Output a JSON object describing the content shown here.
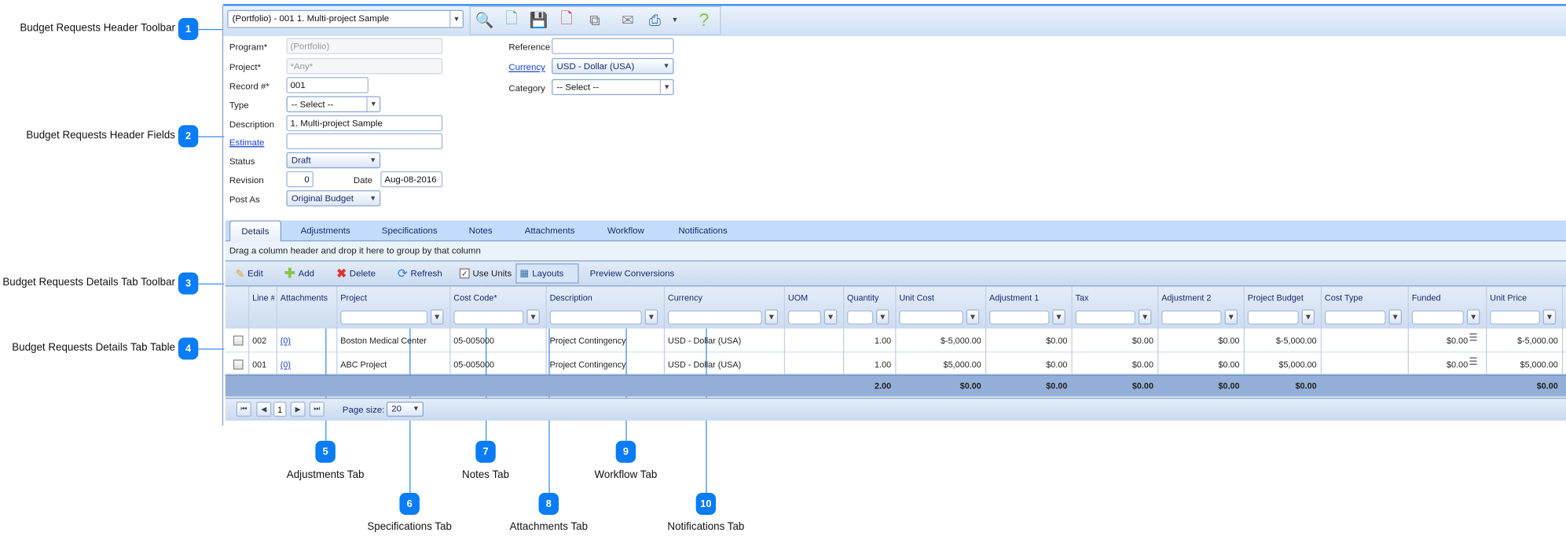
{
  "callouts": [
    {
      "n": "1",
      "label": "Budget Requests Header Toolbar"
    },
    {
      "n": "2",
      "label": "Budget Requests Header Fields"
    },
    {
      "n": "3",
      "label": "Budget Requests Details Tab Toolbar"
    },
    {
      "n": "4",
      "label": "Budget Requests Details Tab Table"
    },
    {
      "n": "5",
      "label": "Adjustments Tab"
    },
    {
      "n": "6",
      "label": "Specifications Tab"
    },
    {
      "n": "7",
      "label": "Notes Tab"
    },
    {
      "n": "8",
      "label": "Attachments Tab"
    },
    {
      "n": "9",
      "label": "Workflow Tab"
    },
    {
      "n": "10",
      "label": "Notifications Tab"
    }
  ],
  "toolbar": {
    "record_select": "(Portfolio) - 001 1. Multi-project Sample",
    "icons": [
      "search-icon",
      "new-document-icon",
      "save-icon",
      "delete-document-icon",
      "copy-icon",
      "email-icon",
      "print-icon",
      "help-icon"
    ],
    "help_glyph": "?"
  },
  "fields": {
    "program": {
      "label": "Program*",
      "value": "(Portfolio)"
    },
    "project": {
      "label": "Project*",
      "value": "*Any*"
    },
    "record": {
      "label": "Record #*",
      "value": "001"
    },
    "type": {
      "label": "Type",
      "value": "-- Select --"
    },
    "description": {
      "label": "Description",
      "value": "1. Multi-project Sample"
    },
    "estimate": {
      "label": "Estimate",
      "value": ""
    },
    "status": {
      "label": "Status",
      "value": "Draft"
    },
    "revision": {
      "label": "Revision",
      "value": "0"
    },
    "date": {
      "label": "Date",
      "value": "Aug-08-2016"
    },
    "post_as": {
      "label": "Post As",
      "value": "Original Budget"
    },
    "reference": {
      "label": "Reference",
      "value": ""
    },
    "currency": {
      "label": "Currency",
      "value": "USD - Dollar (USA)"
    },
    "category": {
      "label": "Category",
      "value": "-- Select --"
    }
  },
  "tabs": [
    "Details",
    "Adjustments",
    "Specifications",
    "Notes",
    "Attachments",
    "Workflow",
    "Notifications"
  ],
  "group_hint": "Drag a column header and drop it here to group by that column",
  "details_toolbar": {
    "edit": "Edit",
    "add": "Add",
    "delete": "Delete",
    "refresh": "Refresh",
    "use_units": "Use Units",
    "use_units_checked": true,
    "layouts": "Layouts",
    "preview": "Preview Conversions"
  },
  "table": {
    "columns": [
      "",
      "Line #",
      "Attachments",
      "Project",
      "Cost Code*",
      "Description",
      "Currency",
      "UOM",
      "Quantity",
      "Unit Cost",
      "Adjustment 1",
      "Tax",
      "Adjustment 2",
      "Project Budget",
      "Cost Type",
      "Funded",
      "Unit Price"
    ],
    "rows": [
      [
        "",
        "002",
        "(0)",
        "Boston Medical Center",
        "05-005000",
        "Project Contingency",
        "USD - Dollar (USA)",
        "",
        "1.00",
        "$-5,000.00",
        "$0.00",
        "$0.00",
        "$0.00",
        "$-5,000.00",
        "",
        "$0.00",
        "$-5,000.00"
      ],
      [
        "",
        "001",
        "(0)",
        "ABC Project",
        "05-005000",
        "Project Contingency",
        "USD - Dollar (USA)",
        "",
        "1.00",
        "$5,000.00",
        "$0.00",
        "$0.00",
        "$0.00",
        "$5,000.00",
        "",
        "$0.00",
        "$5,000.00"
      ]
    ],
    "footer": [
      "",
      "",
      "",
      "",
      "",
      "",
      "",
      "",
      "2.00",
      "$0.00",
      "$0.00",
      "$0.00",
      "$0.00",
      "$0.00",
      "",
      "",
      "$0.00"
    ]
  },
  "pager": {
    "page": "1",
    "page_size_label": "Page size:",
    "page_size": "20"
  },
  "colors": {
    "accent": "#0a7cf5",
    "tab_band": "#c4dcfb",
    "footer": "#93afd8"
  }
}
